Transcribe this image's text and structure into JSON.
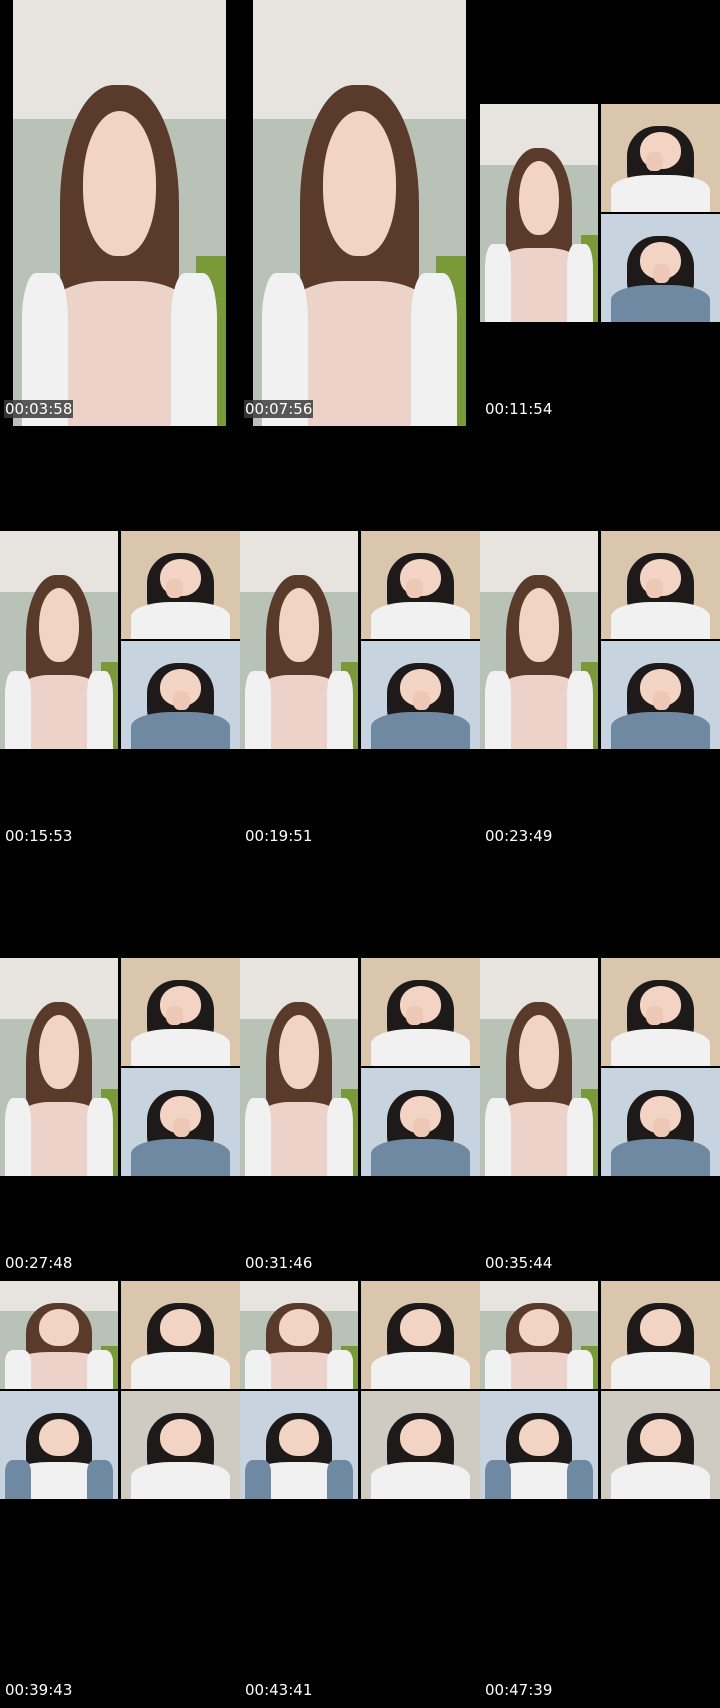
{
  "frames": [
    {
      "timestamp": "00:03:58",
      "layout": "single",
      "boxed": true
    },
    {
      "timestamp": "00:07:56",
      "layout": "single",
      "boxed": true
    },
    {
      "timestamp": "00:11:54",
      "layout": "grid3"
    },
    {
      "timestamp": "00:15:53",
      "layout": "grid3"
    },
    {
      "timestamp": "00:19:51",
      "layout": "grid3"
    },
    {
      "timestamp": "00:23:49",
      "layout": "grid3"
    },
    {
      "timestamp": "00:27:48",
      "layout": "grid3"
    },
    {
      "timestamp": "00:31:46",
      "layout": "grid3"
    },
    {
      "timestamp": "00:35:44",
      "layout": "grid3"
    },
    {
      "timestamp": "00:39:43",
      "layout": "grid4"
    },
    {
      "timestamp": "00:43:41",
      "layout": "grid4"
    },
    {
      "timestamp": "00:47:39",
      "layout": "grid4"
    }
  ],
  "colors": {
    "background": "#000000",
    "wall": "#b9c2b6",
    "ceiling": "#e7e4df",
    "hair_brown": "#5a3b2b",
    "hair_black": "#1e1a1a",
    "top_pink": "#ecd2c8",
    "cardigan_blue": "#6f89a3",
    "white": "#f1f1f1",
    "chair_green": "#7a9a3a",
    "room_wood": "#d9c6ad",
    "light_blue_wall": "#c7d3de"
  }
}
